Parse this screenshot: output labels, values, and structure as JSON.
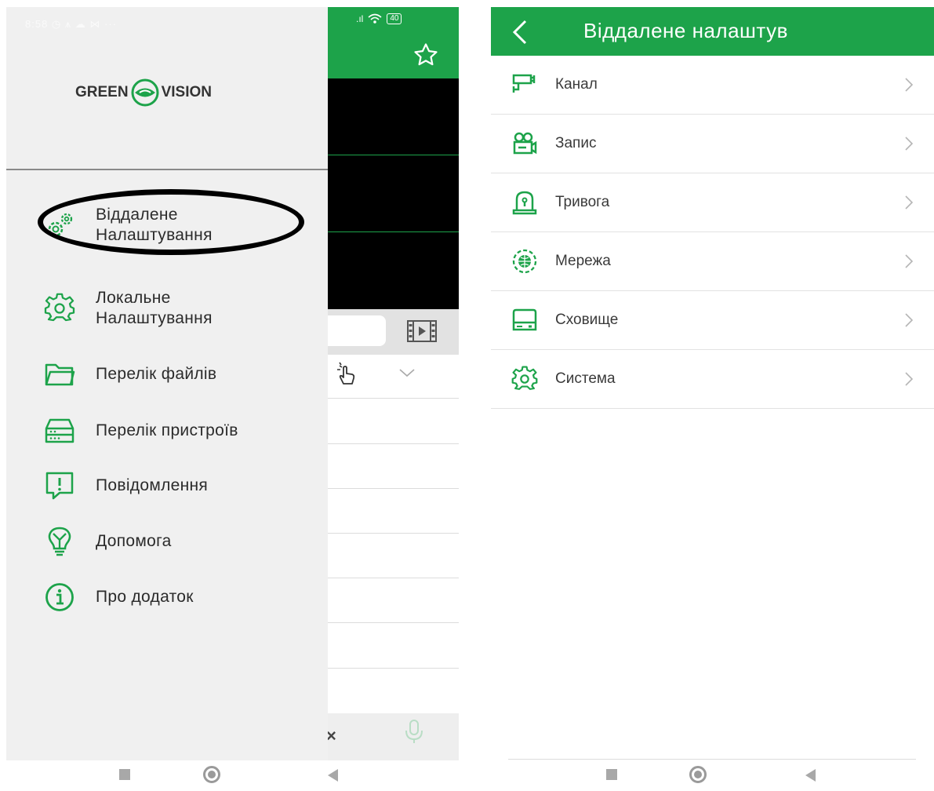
{
  "left_screen": {
    "status_bar": {
      "time_and_icons": "8:58 ◷ ⩚ ☁ ⋈ ···",
      "signal": ".ıl",
      "wifi": "wifi-icon",
      "battery": "40"
    },
    "drawer": {
      "logo": {
        "left": "GREEN",
        "right": "VISION"
      },
      "menu": [
        {
          "label": "Віддалене Налаштування",
          "icon": "remote-settings-icon"
        },
        {
          "label": "Локальне Налаштування",
          "icon": "gear-icon"
        },
        {
          "label": "Перелік файлів",
          "icon": "folder-icon"
        },
        {
          "label": "Перелік пристроїв",
          "icon": "device-list-icon"
        },
        {
          "label": "Повідомлення",
          "icon": "message-icon"
        },
        {
          "label": "Допомога",
          "icon": "help-icon"
        },
        {
          "label": "Про додаток",
          "icon": "info-icon"
        }
      ]
    },
    "background": {
      "close_symbol": "×"
    }
  },
  "right_screen": {
    "header": {
      "title": "Віддалене налаштув"
    },
    "items": [
      {
        "label": "Канал",
        "icon": "camera-channel-icon"
      },
      {
        "label": "Запис",
        "icon": "video-camera-icon"
      },
      {
        "label": "Тривога",
        "icon": "alarm-icon"
      },
      {
        "label": "Мережа",
        "icon": "network-icon"
      },
      {
        "label": "Сховище",
        "icon": "storage-icon"
      },
      {
        "label": "Система",
        "icon": "system-gear-icon"
      }
    ]
  },
  "colors": {
    "accent": "#1da34a",
    "drawer_bg": "#f0f0f0",
    "text": "#2b2b2b"
  }
}
